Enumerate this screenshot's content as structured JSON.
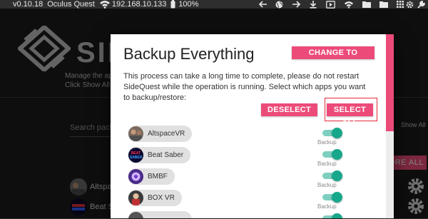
{
  "status_bar": {
    "version": "v0.10.18",
    "device": "Oculus Quest",
    "ip": "192.168.10.133",
    "battery": "100%",
    "wifi_icon": "wifi-icon",
    "battery_icon": "battery-icon",
    "toolbar_icons": [
      "back-arrow-icon",
      "globe-icon",
      "forward-arrow-icon",
      "download-icon",
      "video-icon",
      "wifi-icon",
      "folder-icon",
      "folder-icon",
      "grid-icon",
      "settings-icon",
      "wrench-icon"
    ]
  },
  "background_app": {
    "logo_icon": "sidequest-logo-icon",
    "brand_text": "SIDE",
    "description_lines": [
      "Manage the apps",
      "Click Show All to"
    ],
    "search_placeholder": "Search pack",
    "show_all_label": "Show All",
    "tag_button_label": "ORE ALL",
    "apps": [
      {
        "name": "Altspac"
      },
      {
        "name": "Beat Sa"
      }
    ],
    "gear_icon": "gear-icon"
  },
  "dialog": {
    "title": "Backup Everything",
    "change_button": "CHANGE TO RESTORE",
    "description": "This process can take a long time to complete, please do not restart SideQuest while the operation is running. Select which apps you want to backup/restore:",
    "deselect_all_button": "DESELECT ALL",
    "select_all_button": "SELECT ALL",
    "toggle_label": "Backup",
    "apps": [
      {
        "name": "AltspaceVR",
        "icon": "altspacevr-icon",
        "backup": true
      },
      {
        "name": "Beat Saber",
        "icon": "beat-saber-icon",
        "backup": true
      },
      {
        "name": "BMBF",
        "icon": "bmbf-icon",
        "backup": true
      },
      {
        "name": "BOX VR",
        "icon": "box-vr-icon",
        "backup": true
      },
      {
        "name": "",
        "icon": "app-icon",
        "backup": true
      }
    ],
    "accent_color": "#ec4b79",
    "toggle_color": "#17a78b"
  }
}
